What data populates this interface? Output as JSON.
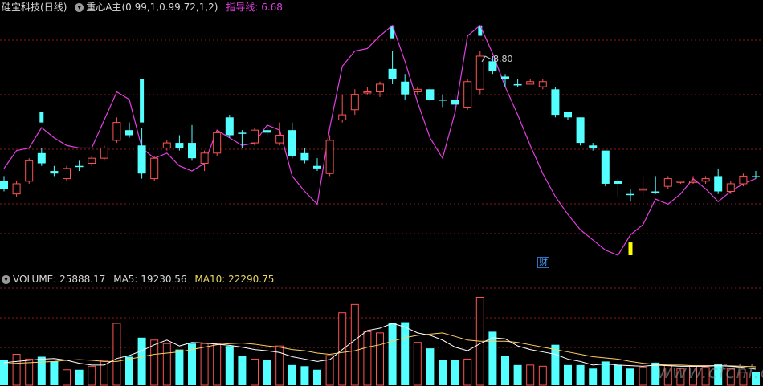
{
  "main_header": {
    "symbol": "硅宝科技",
    "period": "(日线)",
    "indicator_name": "重心A主",
    "indicator_params": "(0.99,1,0.99,72,1,2)",
    "guide_label": "指导线:",
    "guide_value": "6.68"
  },
  "volume_header": {
    "label": "VOLUME:",
    "value": "25888.17",
    "ma5_label": "MA5:",
    "ma5_value": "19230.56",
    "ma10_label": "MA10:",
    "ma10_value": "22290.75"
  },
  "peak_label": "8.80",
  "finance_badge": "财",
  "watermark": "www.cfchi.com",
  "colors": {
    "background": "#000000",
    "up_candle": "#ff5454",
    "down_candle": "#54ffff",
    "guide_line": "#e040e0",
    "signal_up": "#54ffff",
    "signal_down": "#ffff00",
    "ma5": "#ffffff",
    "ma10": "#ffd060",
    "grid": "#8b1a1a"
  },
  "chart_data": {
    "type": "candlestick",
    "note_price_axis": "not printed",
    "candles": [
      {
        "o": 5.85,
        "h": 5.95,
        "l": 5.65,
        "c": 5.7,
        "up": false
      },
      {
        "o": 5.6,
        "h": 5.85,
        "l": 5.55,
        "c": 5.8,
        "up": true
      },
      {
        "o": 5.85,
        "h": 6.3,
        "l": 5.8,
        "c": 6.25,
        "up": true
      },
      {
        "o": 6.4,
        "h": 6.5,
        "l": 6.15,
        "c": 6.2,
        "up": false
      },
      {
        "o": 6.05,
        "h": 6.15,
        "l": 5.95,
        "c": 6.0,
        "up": false
      },
      {
        "o": 5.9,
        "h": 6.15,
        "l": 5.85,
        "c": 6.1,
        "up": true
      },
      {
        "o": 6.15,
        "h": 6.25,
        "l": 6.05,
        "c": 6.15,
        "up": false
      },
      {
        "o": 6.2,
        "h": 6.35,
        "l": 6.15,
        "c": 6.3,
        "up": true
      },
      {
        "o": 6.3,
        "h": 6.55,
        "l": 6.25,
        "c": 6.5,
        "up": true
      },
      {
        "o": 6.65,
        "h": 7.1,
        "l": 6.6,
        "c": 7.0,
        "up": true
      },
      {
        "o": 6.85,
        "h": 7.0,
        "l": 6.7,
        "c": 6.75,
        "up": false
      },
      {
        "o": 6.55,
        "h": 6.9,
        "l": 5.9,
        "c": 6.0,
        "up": false
      },
      {
        "o": 5.9,
        "h": 6.35,
        "l": 5.85,
        "c": 6.3,
        "up": true
      },
      {
        "o": 6.5,
        "h": 6.65,
        "l": 6.45,
        "c": 6.6,
        "up": true
      },
      {
        "o": 6.6,
        "h": 6.75,
        "l": 6.45,
        "c": 6.5,
        "up": false
      },
      {
        "o": 6.6,
        "h": 6.95,
        "l": 6.25,
        "c": 6.3,
        "up": false
      },
      {
        "o": 6.2,
        "h": 6.45,
        "l": 6.05,
        "c": 6.4,
        "up": true
      },
      {
        "o": 6.4,
        "h": 6.85,
        "l": 6.35,
        "c": 6.8,
        "up": true
      },
      {
        "o": 7.1,
        "h": 7.15,
        "l": 6.7,
        "c": 6.75,
        "up": false
      },
      {
        "o": 6.8,
        "h": 6.85,
        "l": 6.5,
        "c": 6.8,
        "up": false
      },
      {
        "o": 6.6,
        "h": 6.9,
        "l": 6.55,
        "c": 6.85,
        "up": true
      },
      {
        "o": 6.85,
        "h": 6.95,
        "l": 6.75,
        "c": 6.8,
        "up": false
      },
      {
        "o": 6.75,
        "h": 7.0,
        "l": 6.55,
        "c": 6.6,
        "up": true
      },
      {
        "o": 6.85,
        "h": 7.0,
        "l": 6.3,
        "c": 6.35,
        "up": false
      },
      {
        "o": 6.4,
        "h": 6.5,
        "l": 6.2,
        "c": 6.25,
        "up": false
      },
      {
        "o": 6.15,
        "h": 6.3,
        "l": 6.05,
        "c": 6.1,
        "up": false
      },
      {
        "o": 6.0,
        "h": 6.75,
        "l": 5.95,
        "c": 6.65,
        "up": true
      },
      {
        "o": 7.05,
        "h": 7.55,
        "l": 7.0,
        "c": 7.15,
        "up": true
      },
      {
        "o": 7.25,
        "h": 7.65,
        "l": 7.15,
        "c": 7.55,
        "up": true
      },
      {
        "o": 7.6,
        "h": 7.7,
        "l": 7.55,
        "c": 7.6,
        "up": true
      },
      {
        "o": 7.6,
        "h": 7.8,
        "l": 7.5,
        "c": 7.75,
        "up": true
      },
      {
        "o": 8.05,
        "h": 8.4,
        "l": 7.75,
        "c": 7.85,
        "up": false
      },
      {
        "o": 7.8,
        "h": 7.95,
        "l": 7.45,
        "c": 7.55,
        "up": false
      },
      {
        "o": 7.65,
        "h": 7.7,
        "l": 7.55,
        "c": 7.6,
        "up": true
      },
      {
        "o": 7.65,
        "h": 7.7,
        "l": 7.4,
        "c": 7.45,
        "up": false
      },
      {
        "o": 7.45,
        "h": 7.55,
        "l": 7.3,
        "c": 7.45,
        "up": false
      },
      {
        "o": 7.45,
        "h": 7.55,
        "l": 7.3,
        "c": 7.35,
        "up": false
      },
      {
        "o": 7.3,
        "h": 7.85,
        "l": 7.25,
        "c": 7.8,
        "up": true
      },
      {
        "o": 7.65,
        "h": 8.4,
        "l": 7.55,
        "c": 8.3,
        "up": true
      },
      {
        "o": 8.2,
        "h": 8.3,
        "l": 7.95,
        "c": 8.0,
        "up": false
      },
      {
        "o": 7.9,
        "h": 7.95,
        "l": 7.7,
        "c": 7.85,
        "up": false
      },
      {
        "o": 7.75,
        "h": 7.85,
        "l": 7.7,
        "c": 7.75,
        "up": false
      },
      {
        "o": 7.75,
        "h": 7.85,
        "l": 7.75,
        "c": 7.8,
        "up": true
      },
      {
        "o": 7.7,
        "h": 7.85,
        "l": 7.65,
        "c": 7.8,
        "up": true
      },
      {
        "o": 7.65,
        "h": 7.7,
        "l": 7.1,
        "c": 7.15,
        "up": false
      },
      {
        "o": 7.2,
        "h": 7.2,
        "l": 7.05,
        "c": 7.1,
        "up": false
      },
      {
        "o": 7.1,
        "h": 7.1,
        "l": 6.55,
        "c": 6.6,
        "up": false
      },
      {
        "o": 6.55,
        "h": 6.6,
        "l": 6.45,
        "c": 6.5,
        "up": false
      },
      {
        "o": 6.45,
        "h": 6.45,
        "l": 5.75,
        "c": 5.8,
        "up": false
      },
      {
        "o": 5.85,
        "h": 5.9,
        "l": 5.55,
        "c": 5.8,
        "up": false
      },
      {
        "o": 5.6,
        "h": 5.7,
        "l": 5.45,
        "c": 5.6,
        "up": false
      },
      {
        "o": 5.7,
        "h": 5.95,
        "l": 5.55,
        "c": 5.7,
        "up": true
      },
      {
        "o": 5.65,
        "h": 5.95,
        "l": 5.6,
        "c": 5.65,
        "up": false
      },
      {
        "o": 5.75,
        "h": 5.95,
        "l": 5.7,
        "c": 5.9,
        "up": true
      },
      {
        "o": 5.85,
        "h": 5.85,
        "l": 5.8,
        "c": 5.85,
        "up": true
      },
      {
        "o": 5.85,
        "h": 5.95,
        "l": 5.8,
        "c": 5.85,
        "up": true
      },
      {
        "o": 5.85,
        "h": 5.95,
        "l": 5.8,
        "c": 5.9,
        "up": true
      },
      {
        "o": 5.95,
        "h": 6.1,
        "l": 5.6,
        "c": 5.65,
        "up": false
      },
      {
        "o": 5.65,
        "h": 5.85,
        "l": 5.6,
        "c": 5.8,
        "up": true
      },
      {
        "o": 5.8,
        "h": 6.0,
        "l": 5.75,
        "c": 5.95,
        "up": true
      },
      {
        "o": 5.95,
        "h": 6.05,
        "l": 5.9,
        "c": 5.95,
        "up": false
      }
    ],
    "guide_line": [
      6.1,
      6.45,
      6.5,
      6.9,
      6.7,
      6.55,
      6.5,
      6.5,
      7.05,
      7.6,
      7.45,
      6.5,
      6.3,
      6.4,
      6.15,
      6.05,
      6.2,
      6.85,
      6.7,
      6.55,
      6.6,
      6.95,
      6.85,
      5.95,
      5.65,
      5.4,
      6.9,
      8.1,
      8.4,
      8.45,
      8.7,
      8.9,
      8.2,
      7.4,
      6.7,
      6.3,
      7.2,
      8.7,
      8.9,
      8.35,
      7.7,
      7.15,
      6.55,
      6.0,
      5.55,
      5.2,
      4.9,
      4.7,
      4.5,
      4.4,
      4.8,
      5.0,
      5.5,
      5.4,
      5.6,
      5.9,
      5.7,
      5.45,
      5.65,
      5.8,
      5.9
    ],
    "signals": [
      {
        "i": 3,
        "type": "up",
        "top": 7.2,
        "bottom": 7.0
      },
      {
        "i": 11,
        "type": "up",
        "top": 7.85,
        "bottom": 7.0
      },
      {
        "i": 31,
        "type": "up",
        "top": 8.9,
        "bottom": 8.65
      },
      {
        "i": 38,
        "type": "up",
        "top": 8.9,
        "bottom": 8.7
      },
      {
        "i": 50,
        "type": "down",
        "top": 4.65,
        "bottom": 4.4
      }
    ],
    "volume": [
      21000,
      26000,
      22000,
      24000,
      20000,
      13000,
      13000,
      16000,
      21000,
      52000,
      24000,
      40000,
      38000,
      35000,
      30000,
      35000,
      35000,
      35000,
      33000,
      25000,
      22000,
      21000,
      33000,
      17000,
      16000,
      13000,
      25000,
      61000,
      68000,
      45000,
      44000,
      52000,
      53000,
      36000,
      31000,
      21000,
      21000,
      22000,
      74000,
      45000,
      25000,
      17000,
      17000,
      16000,
      34000,
      17000,
      17000,
      14000,
      20000,
      17000,
      14000,
      15000,
      19000,
      17000,
      14000,
      16000,
      15000,
      18000,
      14000,
      11000,
      11000
    ],
    "ma5": [
      19000,
      20000,
      21000,
      22000,
      22500,
      21000,
      18500,
      17000,
      17000,
      22500,
      25000,
      29000,
      34000,
      38000,
      33000,
      36000,
      35500,
      34500,
      33500,
      32000,
      30000,
      29000,
      27500,
      24000,
      22000,
      20000,
      21500,
      30000,
      38000,
      46000,
      48000,
      52000,
      49000,
      44000,
      42000,
      38000,
      32000,
      29000,
      35000,
      40000,
      39000,
      33000,
      30000,
      28000,
      26000,
      22000,
      20000,
      17000,
      18000,
      17000,
      16500,
      16000,
      17000,
      16500,
      16000,
      16000,
      16000,
      16500,
      16000,
      15000,
      13500
    ],
    "ma10": [
      18000,
      18500,
      19000,
      19500,
      20000,
      21000,
      21500,
      21000,
      20000,
      20000,
      22000,
      24000,
      26000,
      27000,
      28000,
      30000,
      32000,
      34000,
      35000,
      35500,
      34500,
      33000,
      32000,
      30000,
      29000,
      27000,
      26000,
      27500,
      29000,
      32000,
      34000,
      37000,
      40000,
      42000,
      43000,
      44000,
      41000,
      38000,
      37000,
      37000,
      37000,
      36000,
      34000,
      32000,
      30000,
      28000,
      26000,
      24000,
      23000,
      22000,
      20000,
      18500,
      17500,
      17000,
      17000,
      16500,
      16500,
      16500,
      16300,
      16000,
      15500
    ]
  }
}
